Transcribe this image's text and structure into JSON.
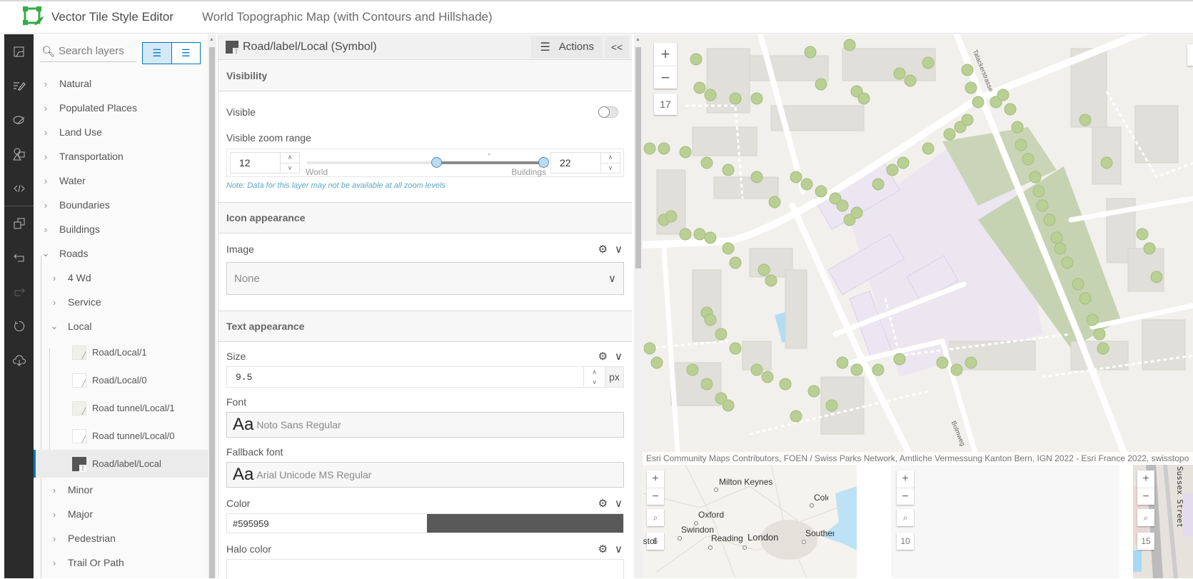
{
  "header": {
    "app_title": "Vector Tile Style Editor",
    "map_title": "World Topographic Map (with Contours and Hillshade)",
    "brand_color": "#35ac46"
  },
  "iconbar": {
    "items": [
      {
        "name": "base-map-icon",
        "label": "Map"
      },
      {
        "name": "edit-layers-icon",
        "label": "Edit layers"
      },
      {
        "name": "edit-colors-icon",
        "label": "Edit colors"
      },
      {
        "name": "edit-icons-icon",
        "label": "Edit icons"
      },
      {
        "name": "code-icon",
        "label": "Code"
      },
      {
        "name": "copy-icon",
        "label": "Copy"
      },
      {
        "name": "undo-icon",
        "label": "Undo"
      },
      {
        "name": "redo-icon",
        "label": "Redo"
      },
      {
        "name": "reset-icon",
        "label": "Reset"
      },
      {
        "name": "save-icon",
        "label": "Save"
      }
    ]
  },
  "layers": {
    "search_placeholder": "Search layers",
    "view_toggle": [
      "group-view",
      "list-view"
    ],
    "groups": [
      {
        "label": "Natural",
        "expanded": false
      },
      {
        "label": "Populated Places",
        "expanded": false
      },
      {
        "label": "Land Use",
        "expanded": false
      },
      {
        "label": "Transportation",
        "expanded": false
      },
      {
        "label": "Water",
        "expanded": false
      },
      {
        "label": "Boundaries",
        "expanded": false
      },
      {
        "label": "Buildings",
        "expanded": false
      },
      {
        "label": "Roads",
        "expanded": true
      }
    ],
    "roads_children": [
      {
        "label": "4 Wd",
        "expanded": false
      },
      {
        "label": "Service",
        "expanded": false
      },
      {
        "label": "Local",
        "expanded": true
      },
      {
        "label": "Minor",
        "expanded": false
      },
      {
        "label": "Major",
        "expanded": false
      },
      {
        "label": "Pedestrian",
        "expanded": false
      },
      {
        "label": "Trail Or Path",
        "expanded": false
      }
    ],
    "local_layers": [
      {
        "label": "Road/Local/1",
        "type": "line",
        "swatch": "#f0efea"
      },
      {
        "label": "Road/Local/0",
        "type": "line",
        "swatch": "#ffffff"
      },
      {
        "label": "Road tunnel/Local/1",
        "type": "line",
        "swatch": "#f0efea"
      },
      {
        "label": "Road tunnel/Local/0",
        "type": "line",
        "swatch": "#ffffff"
      },
      {
        "label": "Road/label/Local",
        "type": "symbol",
        "swatch": "#595959",
        "selected": true
      }
    ]
  },
  "properties": {
    "title": "Road/label/Local (Symbol)",
    "actions_label": "Actions",
    "collapse_label": "<<",
    "visibility": {
      "section": "Visibility",
      "visible_label": "Visible",
      "visible": false,
      "zoom_range_label": "Visible zoom range",
      "min_zoom": "12",
      "max_zoom": "22",
      "slider_min": 0,
      "slider_max": 22,
      "current_zoom_marker": 17,
      "world_label": "World",
      "buildings_label": "Buildings",
      "note": "Note: Data for this layer may not be available at all zoom levels"
    },
    "icon": {
      "section": "Icon appearance",
      "image_label": "Image",
      "image_value": "None"
    },
    "text": {
      "section": "Text appearance",
      "size_label": "Size",
      "size_value": "9.5",
      "size_unit": "px",
      "font_label": "Font",
      "font_sample": "Aa",
      "font_value": "Noto Sans Regular",
      "fallback_label": "Fallback font",
      "fallback_value": "Arial Unicode MS Regular",
      "color_label": "Color",
      "color_value": "#595959",
      "halo_label": "Halo color"
    }
  },
  "map": {
    "zoom_level": "17",
    "street_labels": [
      "Talackerstrasse",
      "Bolmweg"
    ],
    "attribution": "Esri Community Maps Contributors, FOEN / Swiss Parks Network, Amtliche Vermessung Kanton Bern, IGN 2022 - Esri France 2022, swisstopo",
    "previews": [
      {
        "zoom_level": "6",
        "cities": [
          "Milton Keynes",
          "Oxford",
          "Swindon",
          "Reading",
          "London",
          "Bristol",
          "Southend",
          "Colchester"
        ]
      },
      {
        "zoom_level": "10",
        "cities": []
      },
      {
        "zoom_level": "15",
        "street_labels": [
          "Sussex Street"
        ]
      }
    ]
  }
}
